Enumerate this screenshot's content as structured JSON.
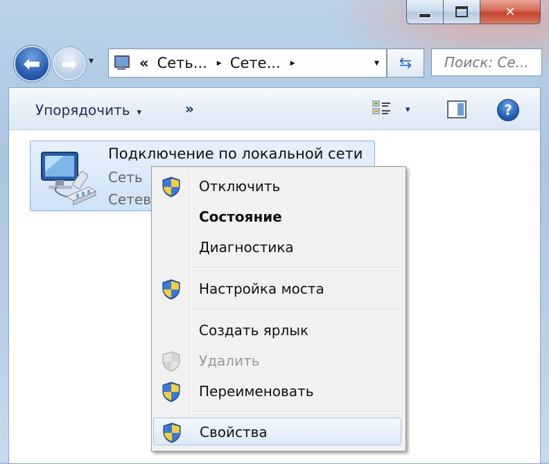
{
  "window": {
    "caption_minimize": "minimize-icon",
    "caption_maximize": "maximize-icon",
    "caption_close": "✕",
    "accent": "#2a5fb4"
  },
  "nav": {
    "back_glyph": "⬅",
    "forward_glyph": "➡",
    "history_dropdown": "▾"
  },
  "address": {
    "prefix": "«",
    "crumbs": [
      "Сеть...",
      "Сете..."
    ],
    "separator": "▸",
    "dropdown": "▾",
    "refresh_glyph": "⇆"
  },
  "search": {
    "placeholder": "Поиск: Се..."
  },
  "toolbar": {
    "organize_label": "Упорядочить",
    "organize_dropdown": "▾",
    "more_label": "»",
    "view_dropdown": "▾",
    "help_label": "?"
  },
  "item": {
    "name": "Подключение по локальной сети",
    "line2": "Сеть",
    "line3": "Сетев"
  },
  "menu": {
    "items": [
      {
        "label": "Отключить",
        "icon": "uac-shield-icon",
        "bold": false,
        "disabled": false
      },
      {
        "label": "Состояние",
        "icon": "",
        "bold": true,
        "disabled": false
      },
      {
        "label": "Диагностика",
        "icon": "",
        "bold": false,
        "disabled": false
      },
      {
        "label": "Настройка моста",
        "icon": "uac-shield-icon",
        "bold": false,
        "disabled": false
      },
      {
        "label": "Создать ярлык",
        "icon": "",
        "bold": false,
        "disabled": false
      },
      {
        "label": "Удалить",
        "icon": "uac-shield-icon",
        "bold": false,
        "disabled": true
      },
      {
        "label": "Переименовать",
        "icon": "uac-shield-icon",
        "bold": false,
        "disabled": false
      },
      {
        "label": "Свойства",
        "icon": "uac-shield-icon",
        "bold": false,
        "disabled": false,
        "highlighted": true
      }
    ]
  }
}
